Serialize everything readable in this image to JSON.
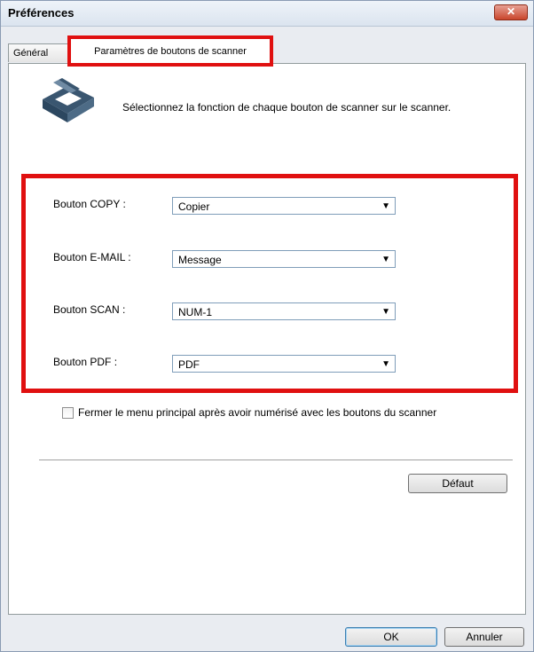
{
  "window": {
    "title": "Préférences",
    "close_glyph": "✕"
  },
  "tabs": [
    {
      "label": "Général"
    },
    {
      "label": "Paramètres de boutons de scanner",
      "selected": true
    }
  ],
  "panel": {
    "icon": "scanner-icon",
    "description": "Sélectionnez la fonction de chaque bouton de scanner sur le scanner.",
    "rows": [
      {
        "label": "Bouton COPY :",
        "value": "Copier"
      },
      {
        "label": "Bouton E-MAIL :",
        "value": "Message"
      },
      {
        "label": "Bouton SCAN :",
        "value": "NUM-1"
      },
      {
        "label": "Bouton PDF :",
        "value": "PDF"
      }
    ],
    "checkbox": {
      "label": "Fermer le menu principal après avoir numérisé avec les boutons du scanner",
      "checked": false
    },
    "default_button": "Défaut"
  },
  "footer": {
    "ok": "OK",
    "cancel": "Annuler"
  },
  "colors": {
    "highlight_red": "#e01010",
    "titlebar": "#dbe4ef",
    "close": "#c9462c"
  }
}
